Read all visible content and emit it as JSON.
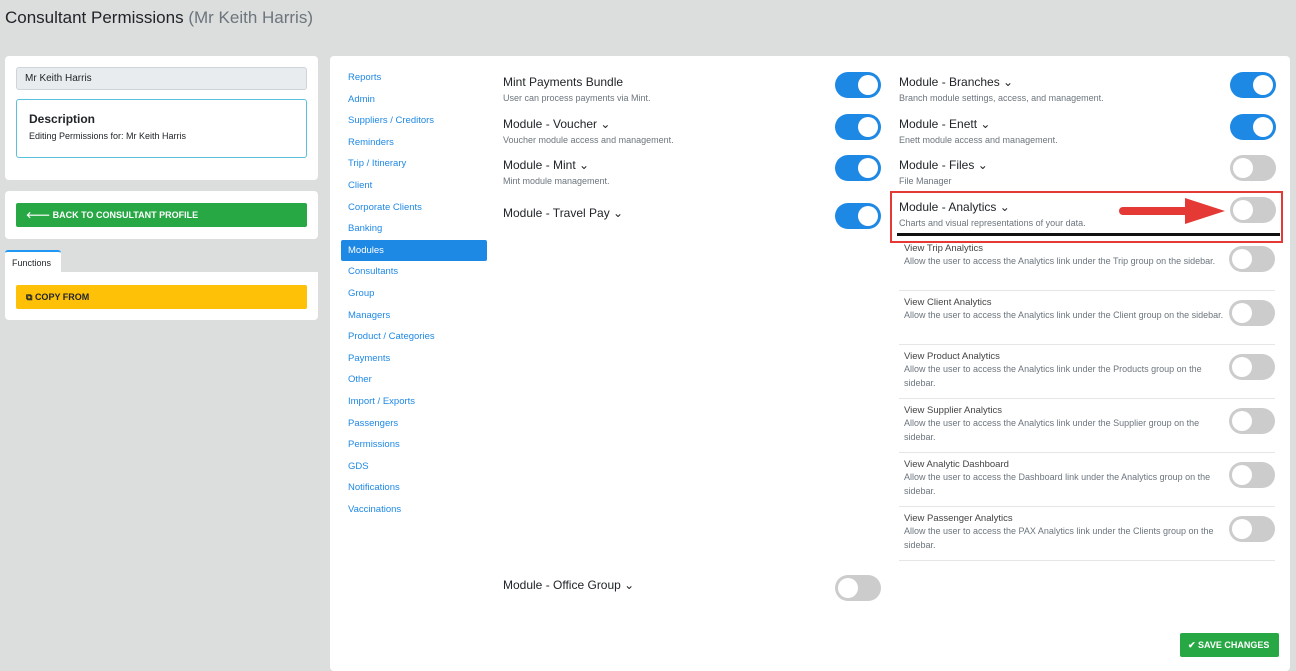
{
  "title": "Consultant Permissions",
  "title_sub": "(Mr Keith Harris)",
  "left": {
    "name": "Mr Keith Harris",
    "desc_title": "Description",
    "desc_text": "Editing Permissions for: Mr Keith Harris",
    "back": "BACK TO CONSULTANT PROFILE",
    "tab": "Functions",
    "copy": "COPY FROM"
  },
  "nav": [
    "Reports",
    "Admin",
    "Suppliers / Creditors",
    "Reminders",
    "Trip / Itinerary",
    "Client",
    "Corporate Clients",
    "Banking",
    "Modules",
    "Consultants",
    "Group",
    "Managers",
    "Product / Categories",
    "Payments",
    "Other",
    "Import / Exports",
    "Passengers",
    "Permissions",
    "GDS",
    "Notifications",
    "Vaccinations"
  ],
  "mid": [
    {
      "title": "Mint Payments Bundle",
      "desc": "User can process payments via Mint.",
      "on": true
    },
    {
      "title": "Module - Voucher ⌄",
      "desc": "Voucher module access and management.",
      "on": true
    },
    {
      "title": "Module - Mint ⌄",
      "desc": "Mint module management.",
      "on": true
    },
    {
      "title": "Module - Travel Pay ⌄",
      "desc": "",
      "on": true
    },
    {
      "title": "Module - Office Group ⌄",
      "desc": "",
      "on": false
    }
  ],
  "right": [
    {
      "title": "Module - Branches ⌄",
      "desc": "Branch module settings, access, and management.",
      "on": true
    },
    {
      "title": "Module - Enett ⌄",
      "desc": "Enett module access and management.",
      "on": true
    },
    {
      "title": "Module - Files ⌄",
      "desc": "File Manager",
      "on": false
    },
    {
      "title": "Module - Analytics ⌄",
      "desc": "Charts and visual representations of your data.",
      "on": false
    }
  ],
  "analytics": [
    {
      "title": "View Trip Analytics",
      "desc": "Allow the user to access the Analytics link under the Trip group on the sidebar."
    },
    {
      "title": "View Client Analytics",
      "desc": "Allow the user to access the Analytics link under the Client group on the sidebar."
    },
    {
      "title": "View Product Analytics",
      "desc": "Allow the user to access the Analytics link under the Products group on the sidebar."
    },
    {
      "title": "View Supplier Analytics",
      "desc": "Allow the user to access the Analytics link under the Supplier group on the sidebar."
    },
    {
      "title": "View Analytic Dashboard",
      "desc": "Allow the user to access the Dashboard link under the Analytics group on the sidebar."
    },
    {
      "title": "View Passenger Analytics",
      "desc": "Allow the user to access the PAX Analytics link under the Clients group on the sidebar."
    }
  ],
  "save": "SAVE CHANGES"
}
